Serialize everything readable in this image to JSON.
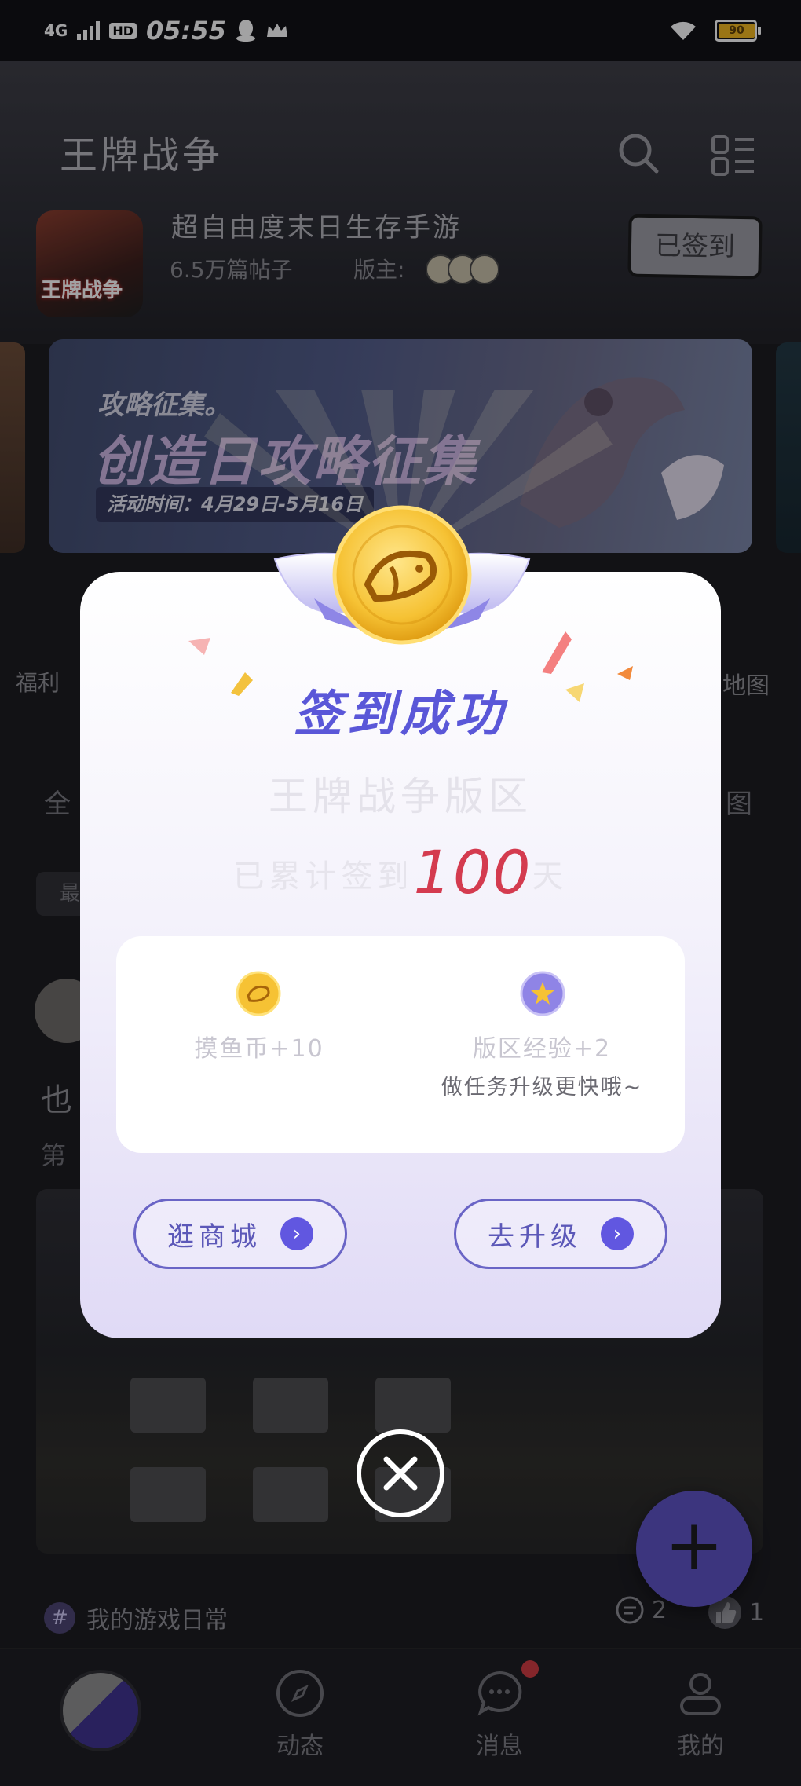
{
  "status_bar": {
    "network": "4G",
    "hd": "HD",
    "time": "05:55",
    "battery": "90"
  },
  "header": {
    "title": "王牌战争"
  },
  "forum": {
    "logo_text": "王牌战争",
    "name": "超自由度末日生存手游",
    "posts": "6.5万篇帖子",
    "moderator_label": "版主:",
    "signed_label": "已签到"
  },
  "banner": {
    "subtitle": "攻略征集。",
    "title": "创造日攻略征集",
    "time_label": "活动时间：4月29日-5月16日"
  },
  "background": {
    "left_quick": "福利",
    "right_quick": "地图",
    "left_tab": "全",
    "right_tab": "图",
    "sort_chip": "最",
    "post_title_fragment": "也",
    "post_sub_fragment": "第",
    "topic": "我的游戏日常",
    "comments": "2",
    "likes": "1"
  },
  "tabbar": {
    "tab2": "动态",
    "tab3": "消息",
    "tab4": "我的"
  },
  "dialog": {
    "title": "签到成功",
    "forum_name": "王牌战争版区",
    "streak_prefix": "已累计签到",
    "streak_days": "100",
    "streak_suffix": "天",
    "reward_coin": "摸鱼币+10",
    "reward_exp": "版区经验+2",
    "reward_tip": "做任务升级更快哦~",
    "btn_mall": "逛商城",
    "btn_upgrade": "去升级"
  },
  "colors": {
    "accent": "#5a57d8",
    "streak": "#d43b4f",
    "fab": "#5b4fc4"
  }
}
